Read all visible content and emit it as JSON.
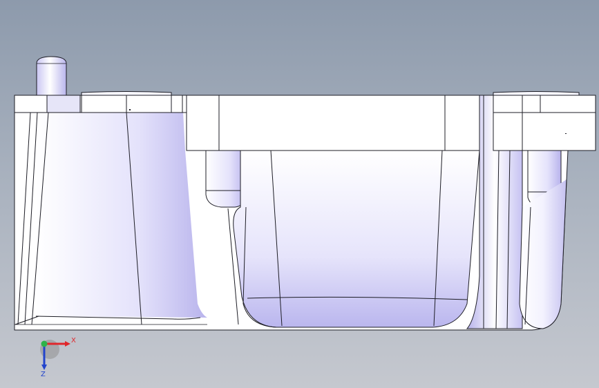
{
  "viewport": {
    "background_top": "#8d9aac",
    "background_bottom": "#c5c8cf"
  },
  "part": {
    "face_color": "#ffffff",
    "shade_color": "#c9c6f2",
    "edge_color": "#1c1c24"
  },
  "triad": {
    "x_label": "X",
    "z_label": "Z",
    "x_color": "#e0262b",
    "y_color": "#2fb34a",
    "z_color": "#2244cc"
  }
}
